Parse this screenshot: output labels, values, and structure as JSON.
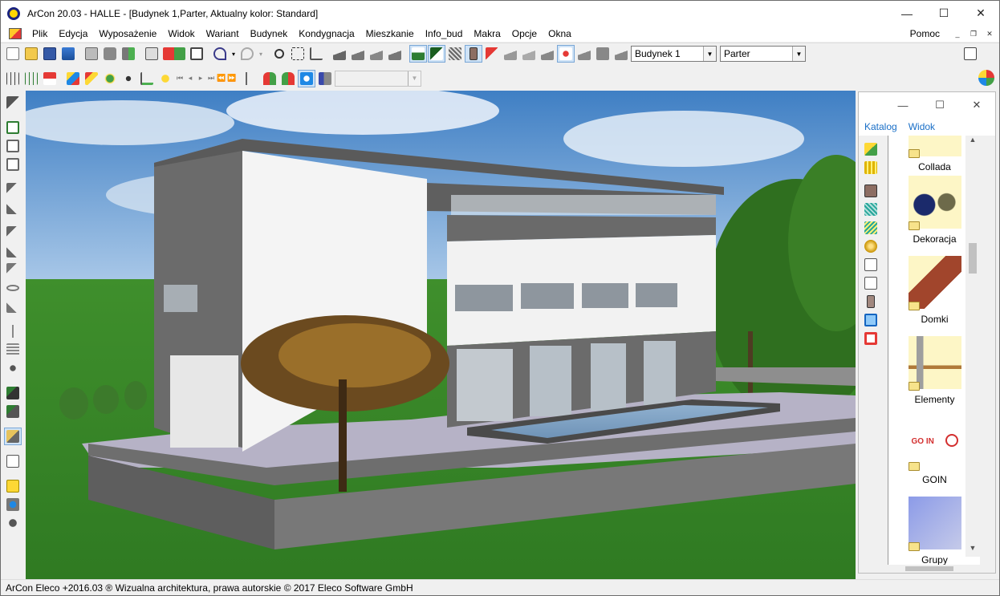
{
  "window": {
    "title": "ArCon 20.03 - HALLE - [Budynek 1,Parter, Aktualny kolor: Standard]",
    "controls": {
      "minimize": "—",
      "maximize": "☐",
      "close": "✕"
    }
  },
  "menu": {
    "items": [
      "Plik",
      "Edycja",
      "Wyposażenie",
      "Widok",
      "Wariant",
      "Budynek",
      "Kondygnacja",
      "Mieszkanie",
      "Info_bud",
      "Makra",
      "Opcje",
      "Okna"
    ],
    "help": "Pomoc",
    "mdi": {
      "minimize": "_",
      "restore": "❐",
      "close": "✕"
    }
  },
  "toolbar": {
    "building_select": "Budynek 1",
    "floor_select": "Parter",
    "empty_select": ""
  },
  "catalog": {
    "controls": {
      "minimize": "—",
      "maximize": "☐",
      "close": "✕"
    },
    "menu": [
      "Katalog",
      "Widok"
    ],
    "entries": [
      "Collada",
      "Dekoracja",
      "Domki",
      "Elementy",
      "GOIN",
      "Grupy"
    ],
    "goin_logo": "GO IN"
  },
  "status": {
    "text": "ArCon Eleco +2016.03 ® Wizualna architektura, prawa autorskie © 2017 Eleco Software GmbH"
  }
}
